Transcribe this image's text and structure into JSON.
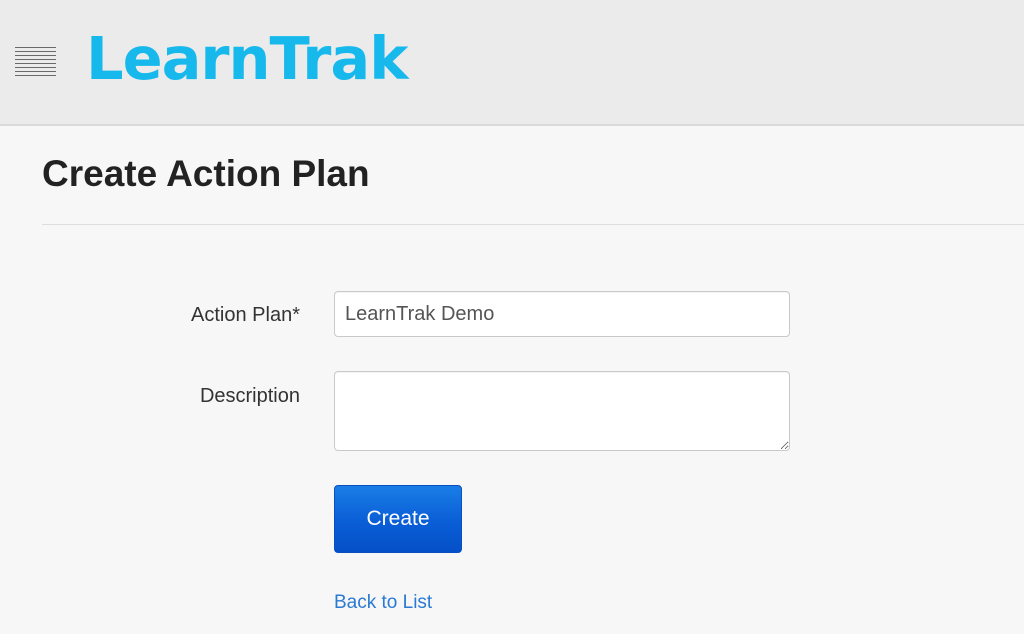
{
  "app": {
    "logo_text": "LearnTrak",
    "brand_color": "#17b9ec"
  },
  "header": {
    "menu_icon": "hamburger-menu-icon"
  },
  "page": {
    "title": "Create Action Plan"
  },
  "form": {
    "action_plan": {
      "label": "Action Plan*",
      "value": "LearnTrak Demo",
      "placeholder": ""
    },
    "description": {
      "label": "Description",
      "value": "",
      "placeholder": ""
    },
    "create_label": "Create",
    "create_color": "#0a5ed6"
  },
  "links": {
    "back_label": "Back to List",
    "link_color": "#2a7ad2"
  }
}
